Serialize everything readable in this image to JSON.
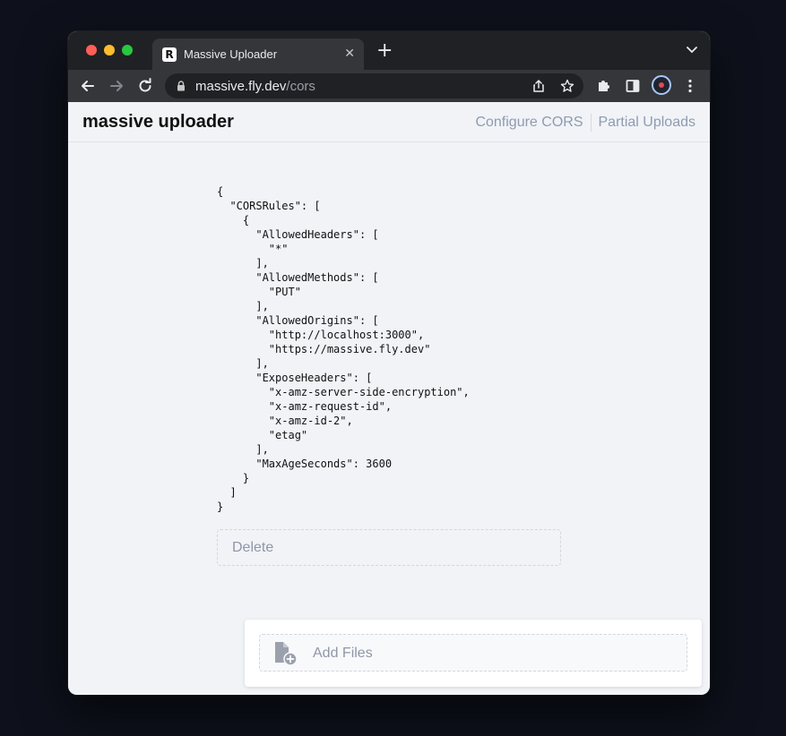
{
  "browser": {
    "tab_title": "Massive Uploader",
    "tab_favicon": "R",
    "tab_close": "✕",
    "new_tab": "+",
    "url_host": "massive.fly.dev",
    "url_path": "/cors"
  },
  "icons": {
    "back": "arrow-left-icon",
    "forward": "arrow-right-icon",
    "reload": "reload-icon",
    "lock": "lock-icon",
    "share": "share-icon",
    "bookmark": "star-icon",
    "extensions": "puzzle-icon",
    "sidepanel": "side-panel-icon",
    "menu": "kebab-menu-icon",
    "file_add": "file-add-icon"
  },
  "app": {
    "brand": "massive uploader",
    "nav": {
      "configure_cors": "Configure CORS",
      "partial_uploads": "Partial Uploads"
    },
    "cors_json": "{\n  \"CORSRules\": [\n    {\n      \"AllowedHeaders\": [\n        \"*\"\n      ],\n      \"AllowedMethods\": [\n        \"PUT\"\n      ],\n      \"AllowedOrigins\": [\n        \"http://localhost:3000\",\n        \"https://massive.fly.dev\"\n      ],\n      \"ExposeHeaders\": [\n        \"x-amz-server-side-encryption\",\n        \"x-amz-request-id\",\n        \"x-amz-id-2\",\n        \"etag\"\n      ],\n      \"MaxAgeSeconds\": 3600\n    }\n  ]\n}",
    "delete_label": "Delete",
    "add_files_label": "Add Files"
  },
  "colors": {
    "desktop": "#0e111b",
    "tabstrip": "#202124",
    "toolbar": "#35363a",
    "page_bg": "#f1f3f7",
    "nav_link": "#8f9bb0",
    "muted_text": "#8f97a6"
  }
}
